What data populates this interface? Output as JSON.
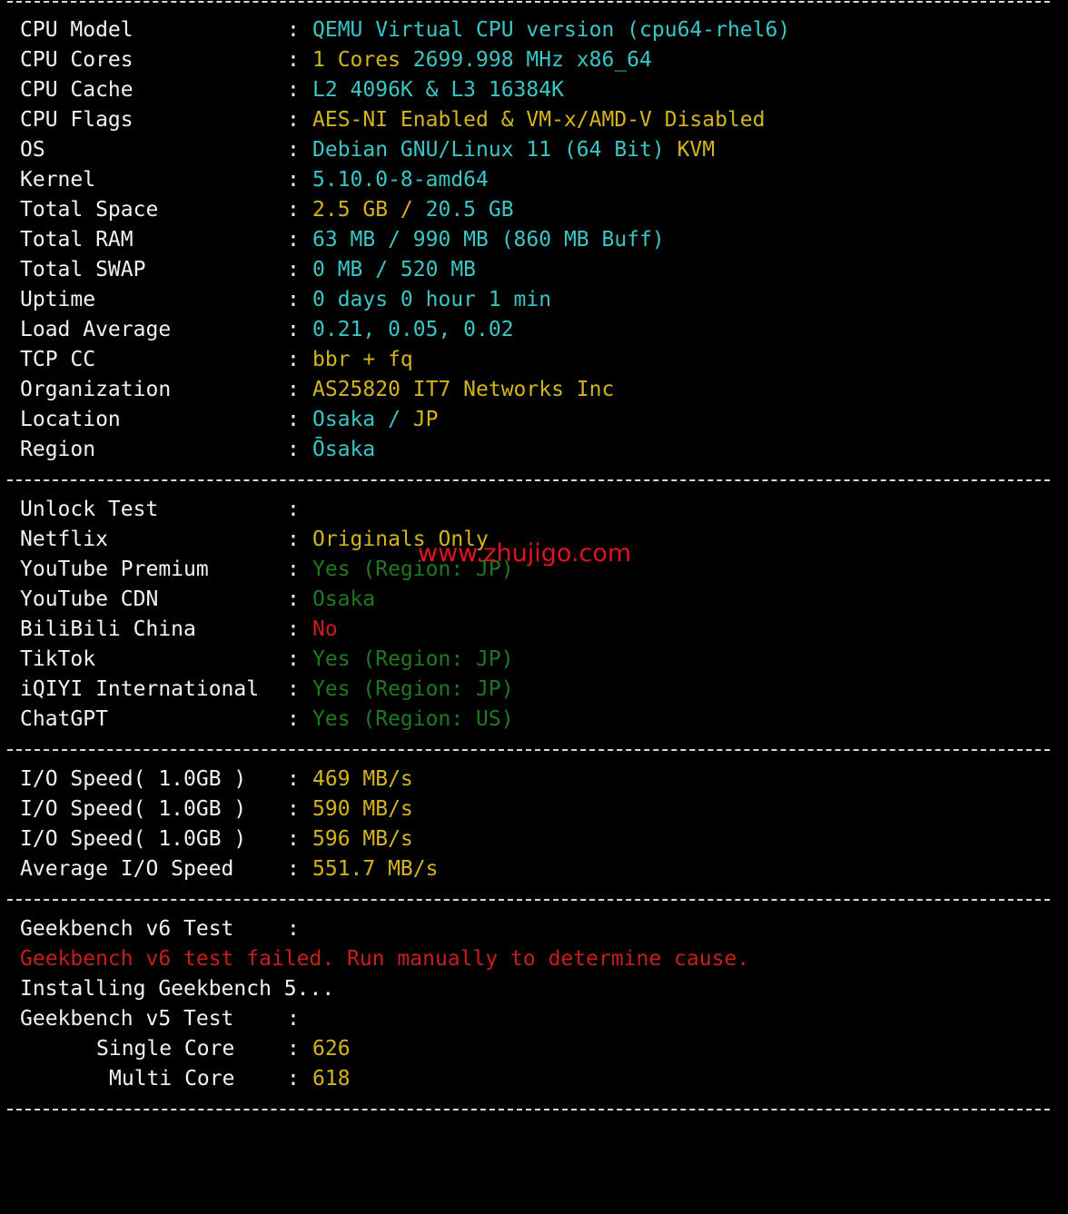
{
  "system_info": [
    {
      "label": "CPU Model",
      "segments": [
        {
          "text": "QEMU Virtual CPU version (cpu64-rhel6)",
          "color": "#3ac6c6"
        }
      ]
    },
    {
      "label": "CPU Cores",
      "segments": [
        {
          "text": "1 Cores ",
          "color": "#d4b41d"
        },
        {
          "text": "2699.998 MHz x86_64",
          "color": "#3ac6c6"
        }
      ]
    },
    {
      "label": "CPU Cache",
      "segments": [
        {
          "text": "L2 4096K & L3 16384K",
          "color": "#3ac6c6"
        }
      ]
    },
    {
      "label": "CPU Flags",
      "segments": [
        {
          "text": "AES-NI Enabled & VM-x/AMD-V Disabled",
          "color": "#d4b41d"
        }
      ]
    },
    {
      "label": "OS",
      "segments": [
        {
          "text": "Debian GNU/Linux 11 (64 Bit) ",
          "color": "#3ac6c6"
        },
        {
          "text": "KVM",
          "color": "#d4b41d"
        }
      ]
    },
    {
      "label": "Kernel",
      "segments": [
        {
          "text": "5.10.0-8-amd64",
          "color": "#3ac6c6"
        }
      ]
    },
    {
      "label": "Total Space",
      "segments": [
        {
          "text": "2.5 GB / ",
          "color": "#d4b41d"
        },
        {
          "text": "20.5 GB",
          "color": "#3ac6c6"
        }
      ]
    },
    {
      "label": "Total RAM",
      "segments": [
        {
          "text": "63 MB / 990 MB (860 MB Buff)",
          "color": "#3ac6c6"
        }
      ]
    },
    {
      "label": "Total SWAP",
      "segments": [
        {
          "text": "0 MB / 520 MB",
          "color": "#3ac6c6"
        }
      ]
    },
    {
      "label": "Uptime",
      "segments": [
        {
          "text": "0 days 0 hour 1 min",
          "color": "#3ac6c6"
        }
      ]
    },
    {
      "label": "Load Average",
      "segments": [
        {
          "text": "0.21, 0.05, 0.02",
          "color": "#3ac6c6"
        }
      ]
    },
    {
      "label": "TCP CC",
      "segments": [
        {
          "text": "bbr + fq",
          "color": "#d4b41d"
        }
      ]
    },
    {
      "label": "Organization",
      "segments": [
        {
          "text": "AS25820 IT7 Networks Inc",
          "color": "#d4b41d"
        }
      ]
    },
    {
      "label": "Location",
      "segments": [
        {
          "text": "Osaka / ",
          "color": "#3ac6c6"
        },
        {
          "text": "JP",
          "color": "#d4b41d"
        }
      ]
    },
    {
      "label": "Region",
      "segments": [
        {
          "text": "Ōsaka",
          "color": "#3ac6c6"
        }
      ]
    }
  ],
  "unlock_test": [
    {
      "label": "Unlock Test",
      "segments": []
    },
    {
      "label": "Netflix",
      "segments": [
        {
          "text": "Originals Only",
          "color": "#d4b41d"
        }
      ]
    },
    {
      "label": "YouTube Premium",
      "segments": [
        {
          "text": "Yes (Region: JP)",
          "color": "#1f7a1f"
        }
      ]
    },
    {
      "label": "YouTube CDN",
      "segments": [
        {
          "text": "Osaka",
          "color": "#1f7a1f"
        }
      ]
    },
    {
      "label": "BiliBili China",
      "segments": [
        {
          "text": "No",
          "color": "#c81e1e"
        }
      ]
    },
    {
      "label": "TikTok",
      "segments": [
        {
          "text": "Yes (Region: JP)",
          "color": "#1f7a1f"
        }
      ]
    },
    {
      "label": "iQIYI International",
      "segments": [
        {
          "text": "Yes (Region: JP)",
          "color": "#1f7a1f"
        }
      ]
    },
    {
      "label": "ChatGPT",
      "segments": [
        {
          "text": "Yes (Region: US)",
          "color": "#1f7a1f"
        }
      ]
    }
  ],
  "io_test": [
    {
      "label": "I/O Speed( 1.0GB )",
      "segments": [
        {
          "text": "469 MB/s",
          "color": "#d4b41d"
        }
      ]
    },
    {
      "label": "I/O Speed( 1.0GB )",
      "segments": [
        {
          "text": "590 MB/s",
          "color": "#d4b41d"
        }
      ]
    },
    {
      "label": "I/O Speed( 1.0GB )",
      "segments": [
        {
          "text": "596 MB/s",
          "color": "#d4b41d"
        }
      ]
    },
    {
      "label": "Average I/O Speed",
      "segments": [
        {
          "text": "551.7 MB/s",
          "color": "#d4b41d"
        }
      ]
    }
  ],
  "geekbench": {
    "v6_label": "Geekbench v6 Test",
    "v6_error": "Geekbench v6 test failed. Run manually to determine cause.",
    "installing": "Installing Geekbench 5...",
    "v5_label": "Geekbench v5 Test",
    "single_core_label": "Single Core",
    "single_core_value": "626",
    "multi_core_label": "Multi Core",
    "multi_core_value": "618"
  },
  "watermark": "www.zhujigo.com",
  "colors": {
    "cyan": "#3ac6c6",
    "yellow": "#d4b41d",
    "green": "#1f7a1f",
    "red": "#c81e1e",
    "white": "#f2f2f2",
    "background": "#000000"
  }
}
